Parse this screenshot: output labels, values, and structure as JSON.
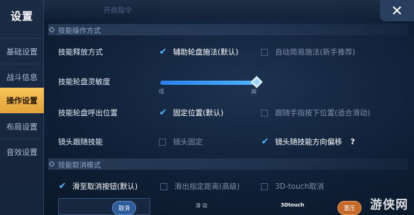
{
  "header": {
    "title": "设置",
    "faint_text": "开启指令",
    "close_glyph": "✕"
  },
  "sidebar": {
    "items": [
      {
        "label": "基础设置",
        "active": false
      },
      {
        "label": "战斗信息",
        "active": false
      },
      {
        "label": "操作设置",
        "active": true
      },
      {
        "label": "布局设置",
        "active": false
      },
      {
        "label": "音效设置",
        "active": false
      }
    ]
  },
  "sections": {
    "skill_operation": "技能操作方式",
    "skill_cancel": "技能取消模式"
  },
  "rows": {
    "cast_mode": {
      "label": "技能释放方式",
      "options": [
        {
          "text": "辅助轮盘施法(默认)",
          "checked": true
        },
        {
          "text": "自动简易施法(新手推荐)",
          "checked": false
        }
      ]
    },
    "wheel_sensitivity": {
      "label": "技能轮盘灵敏度",
      "low": "低",
      "high": "高",
      "value_fraction": 1.0
    },
    "wheel_position": {
      "label": "技能轮盘呼出位置",
      "options": [
        {
          "text": "固定位置(默认)",
          "checked": true
        },
        {
          "text": "跟随手指按下位置(适合滑动)",
          "checked": false
        }
      ]
    },
    "camera_follow": {
      "label": "镜头跟随技能",
      "options": [
        {
          "text": "镜头固定",
          "checked": false
        },
        {
          "text": "镜头随技能方向偏移",
          "checked": true
        }
      ],
      "help": "?"
    },
    "cancel_mode": {
      "options": [
        {
          "text": "滑至取消按钮(默认)",
          "checked": true
        },
        {
          "text": "滑出指定距离(高级)",
          "checked": false
        },
        {
          "text": "3D-touch取消",
          "checked": false
        }
      ]
    }
  },
  "preview": {
    "cancel_label": "取消",
    "slide_label": "滑 动",
    "touch_label": "3Dtouch",
    "press_label": "重压"
  },
  "watermark": "游侠网",
  "colors": {
    "accent": "#4fb4ff",
    "active_tab": "#f6c65a"
  }
}
